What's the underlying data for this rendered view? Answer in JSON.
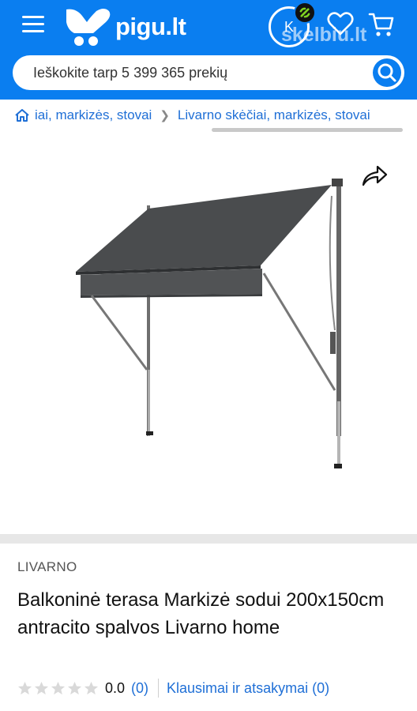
{
  "header": {
    "logo_text": "pigu.lt",
    "avatar_initial": "K",
    "watermark": "skelbiu.lt"
  },
  "search": {
    "placeholder": "Ieškokite tarp 5 399 365 prekių"
  },
  "breadcrumb": {
    "items": [
      {
        "label": "iai, markizės, stovai"
      },
      {
        "label": "Livarno skėčiai, markizės, stovai"
      }
    ]
  },
  "product": {
    "brand": "LIVARNO",
    "title": "Balkoninė terasa Markizė sodui 200x150cm antracito spalvos Livarno home",
    "rating_value": "0.0",
    "rating_count": "(0)",
    "qa_link": "Klausimai ir atsakymai (0)",
    "stars": 0
  },
  "colors": {
    "brand_blue": "#0a7ef0",
    "link_blue": "#1f6fd6"
  },
  "icons": [
    "menu-icon",
    "cart-icon",
    "heart-icon",
    "search-icon",
    "home-icon",
    "share-icon",
    "chevron-right-icon",
    "star-icon"
  ]
}
